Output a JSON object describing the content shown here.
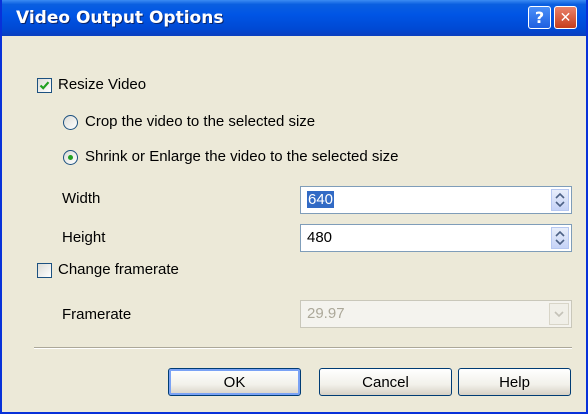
{
  "window": {
    "title": "Video Output Options"
  },
  "titlebar": {
    "help_glyph": "?",
    "close_glyph": "✕"
  },
  "resize": {
    "label": "Resize Video",
    "checked": true
  },
  "options": {
    "crop_label": "Crop the video to the selected size",
    "shrink_label": "Shrink or Enlarge the video to the selected size",
    "selected": "shrink"
  },
  "width": {
    "label": "Width",
    "value": "640"
  },
  "height": {
    "label": "Height",
    "value": "480"
  },
  "change_framerate": {
    "label": "Change framerate",
    "checked": false
  },
  "framerate": {
    "label": "Framerate",
    "value": "29.97"
  },
  "buttons": {
    "ok": "OK",
    "cancel": "Cancel",
    "help": "Help"
  },
  "colors": {
    "title_bar": "#0055e5",
    "check_mark": "#21a121",
    "selection": "#316ac5"
  }
}
